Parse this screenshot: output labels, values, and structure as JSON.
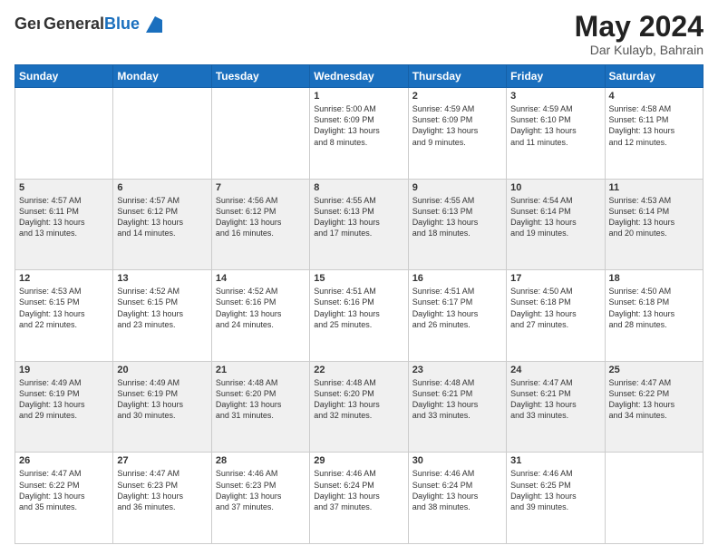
{
  "header": {
    "logo_general": "General",
    "logo_blue": "Blue",
    "month": "May 2024",
    "location": "Dar Kulayb, Bahrain"
  },
  "days_of_week": [
    "Sunday",
    "Monday",
    "Tuesday",
    "Wednesday",
    "Thursday",
    "Friday",
    "Saturday"
  ],
  "weeks": [
    {
      "shade": false,
      "days": [
        {
          "num": "",
          "info": ""
        },
        {
          "num": "",
          "info": ""
        },
        {
          "num": "",
          "info": ""
        },
        {
          "num": "1",
          "info": "Sunrise: 5:00 AM\nSunset: 6:09 PM\nDaylight: 13 hours\nand 8 minutes."
        },
        {
          "num": "2",
          "info": "Sunrise: 4:59 AM\nSunset: 6:09 PM\nDaylight: 13 hours\nand 9 minutes."
        },
        {
          "num": "3",
          "info": "Sunrise: 4:59 AM\nSunset: 6:10 PM\nDaylight: 13 hours\nand 11 minutes."
        },
        {
          "num": "4",
          "info": "Sunrise: 4:58 AM\nSunset: 6:11 PM\nDaylight: 13 hours\nand 12 minutes."
        }
      ]
    },
    {
      "shade": true,
      "days": [
        {
          "num": "5",
          "info": "Sunrise: 4:57 AM\nSunset: 6:11 PM\nDaylight: 13 hours\nand 13 minutes."
        },
        {
          "num": "6",
          "info": "Sunrise: 4:57 AM\nSunset: 6:12 PM\nDaylight: 13 hours\nand 14 minutes."
        },
        {
          "num": "7",
          "info": "Sunrise: 4:56 AM\nSunset: 6:12 PM\nDaylight: 13 hours\nand 16 minutes."
        },
        {
          "num": "8",
          "info": "Sunrise: 4:55 AM\nSunset: 6:13 PM\nDaylight: 13 hours\nand 17 minutes."
        },
        {
          "num": "9",
          "info": "Sunrise: 4:55 AM\nSunset: 6:13 PM\nDaylight: 13 hours\nand 18 minutes."
        },
        {
          "num": "10",
          "info": "Sunrise: 4:54 AM\nSunset: 6:14 PM\nDaylight: 13 hours\nand 19 minutes."
        },
        {
          "num": "11",
          "info": "Sunrise: 4:53 AM\nSunset: 6:14 PM\nDaylight: 13 hours\nand 20 minutes."
        }
      ]
    },
    {
      "shade": false,
      "days": [
        {
          "num": "12",
          "info": "Sunrise: 4:53 AM\nSunset: 6:15 PM\nDaylight: 13 hours\nand 22 minutes."
        },
        {
          "num": "13",
          "info": "Sunrise: 4:52 AM\nSunset: 6:15 PM\nDaylight: 13 hours\nand 23 minutes."
        },
        {
          "num": "14",
          "info": "Sunrise: 4:52 AM\nSunset: 6:16 PM\nDaylight: 13 hours\nand 24 minutes."
        },
        {
          "num": "15",
          "info": "Sunrise: 4:51 AM\nSunset: 6:16 PM\nDaylight: 13 hours\nand 25 minutes."
        },
        {
          "num": "16",
          "info": "Sunrise: 4:51 AM\nSunset: 6:17 PM\nDaylight: 13 hours\nand 26 minutes."
        },
        {
          "num": "17",
          "info": "Sunrise: 4:50 AM\nSunset: 6:18 PM\nDaylight: 13 hours\nand 27 minutes."
        },
        {
          "num": "18",
          "info": "Sunrise: 4:50 AM\nSunset: 6:18 PM\nDaylight: 13 hours\nand 28 minutes."
        }
      ]
    },
    {
      "shade": true,
      "days": [
        {
          "num": "19",
          "info": "Sunrise: 4:49 AM\nSunset: 6:19 PM\nDaylight: 13 hours\nand 29 minutes."
        },
        {
          "num": "20",
          "info": "Sunrise: 4:49 AM\nSunset: 6:19 PM\nDaylight: 13 hours\nand 30 minutes."
        },
        {
          "num": "21",
          "info": "Sunrise: 4:48 AM\nSunset: 6:20 PM\nDaylight: 13 hours\nand 31 minutes."
        },
        {
          "num": "22",
          "info": "Sunrise: 4:48 AM\nSunset: 6:20 PM\nDaylight: 13 hours\nand 32 minutes."
        },
        {
          "num": "23",
          "info": "Sunrise: 4:48 AM\nSunset: 6:21 PM\nDaylight: 13 hours\nand 33 minutes."
        },
        {
          "num": "24",
          "info": "Sunrise: 4:47 AM\nSunset: 6:21 PM\nDaylight: 13 hours\nand 33 minutes."
        },
        {
          "num": "25",
          "info": "Sunrise: 4:47 AM\nSunset: 6:22 PM\nDaylight: 13 hours\nand 34 minutes."
        }
      ]
    },
    {
      "shade": false,
      "days": [
        {
          "num": "26",
          "info": "Sunrise: 4:47 AM\nSunset: 6:22 PM\nDaylight: 13 hours\nand 35 minutes."
        },
        {
          "num": "27",
          "info": "Sunrise: 4:47 AM\nSunset: 6:23 PM\nDaylight: 13 hours\nand 36 minutes."
        },
        {
          "num": "28",
          "info": "Sunrise: 4:46 AM\nSunset: 6:23 PM\nDaylight: 13 hours\nand 37 minutes."
        },
        {
          "num": "29",
          "info": "Sunrise: 4:46 AM\nSunset: 6:24 PM\nDaylight: 13 hours\nand 37 minutes."
        },
        {
          "num": "30",
          "info": "Sunrise: 4:46 AM\nSunset: 6:24 PM\nDaylight: 13 hours\nand 38 minutes."
        },
        {
          "num": "31",
          "info": "Sunrise: 4:46 AM\nSunset: 6:25 PM\nDaylight: 13 hours\nand 39 minutes."
        },
        {
          "num": "",
          "info": ""
        }
      ]
    }
  ]
}
